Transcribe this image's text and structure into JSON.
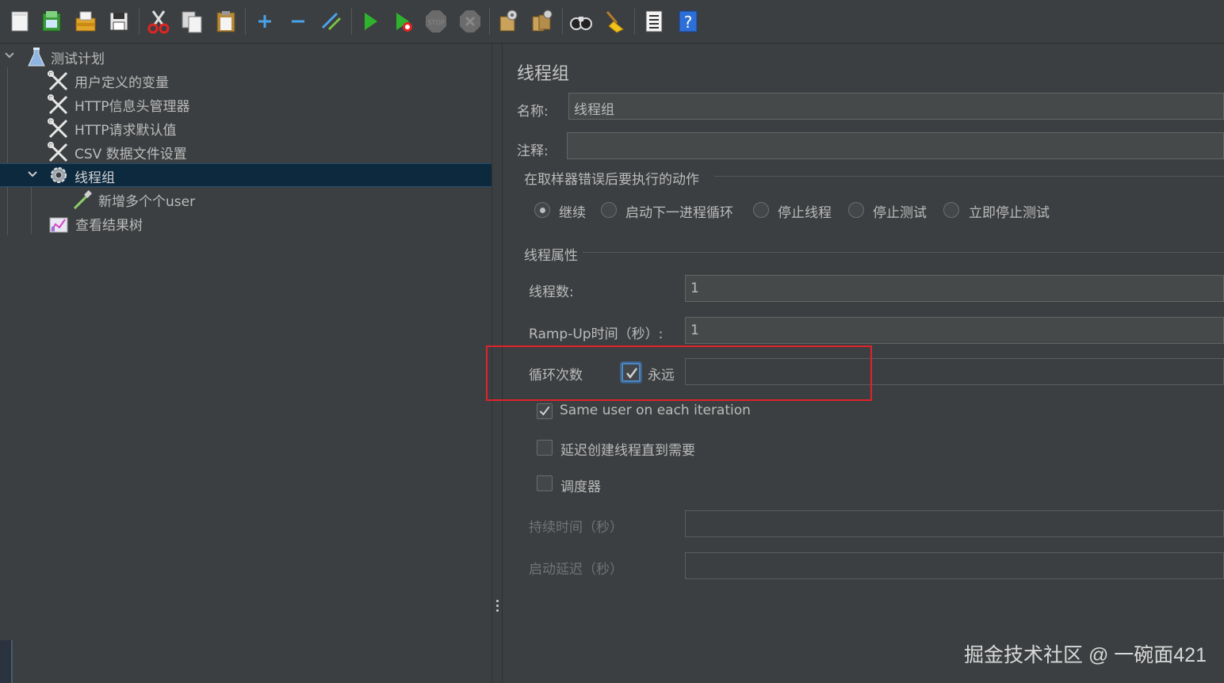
{
  "toolbar": {
    "buttons": [
      {
        "icon": "new-icon"
      },
      {
        "icon": "templates-icon"
      },
      {
        "icon": "open-icon"
      },
      {
        "icon": "save-icon"
      },
      {
        "icon": "cut-icon"
      },
      {
        "icon": "copy-icon"
      },
      {
        "icon": "paste-icon"
      },
      {
        "icon": "expand-icon"
      },
      {
        "icon": "collapse-icon"
      },
      {
        "icon": "toggle-icon"
      },
      {
        "icon": "start-icon"
      },
      {
        "icon": "start-no-pauses-icon"
      },
      {
        "icon": "stop-icon",
        "label": "STOP"
      },
      {
        "icon": "shutdown-icon"
      },
      {
        "icon": "clear-icon"
      },
      {
        "icon": "clear-all-icon"
      },
      {
        "icon": "search-icon"
      },
      {
        "icon": "reset-search-icon"
      },
      {
        "icon": "function-helper-icon"
      },
      {
        "icon": "help-icon",
        "label": "?"
      }
    ]
  },
  "tree": {
    "items": [
      {
        "label": "测试计划",
        "icon": "test-plan-icon",
        "expanded": true
      },
      {
        "label": "用户定义的变量",
        "icon": "config-element-icon"
      },
      {
        "label": "HTTP信息头管理器",
        "icon": "config-element-icon"
      },
      {
        "label": "HTTP请求默认值",
        "icon": "config-element-icon"
      },
      {
        "label": "CSV 数据文件设置",
        "icon": "config-element-icon"
      },
      {
        "label": "线程组",
        "icon": "thread-group-gear-icon",
        "expanded": true,
        "selected": true
      },
      {
        "label": "新增多个个user",
        "icon": "sampler-pipette-icon"
      },
      {
        "label": "查看结果树",
        "icon": "listener-chart-icon"
      }
    ]
  },
  "panel": {
    "title": "线程组",
    "name_label": "名称:",
    "name_value": "线程组",
    "comment_label": "注释:",
    "comment_value": "",
    "error_action": {
      "legend": "在取样器错误后要执行的动作",
      "options": [
        "继续",
        "启动下一进程循环",
        "停止线程",
        "停止测试",
        "立即停止测试"
      ],
      "selected": "继续"
    },
    "thread_props": {
      "legend": "线程属性",
      "threads_label": "线程数:",
      "threads_value": "1",
      "rampup_label": "Ramp-Up时间（秒）:",
      "rampup_value": "1",
      "loop_label": "循环次数",
      "forever_label": "永远",
      "forever_checked": true,
      "loop_value": "",
      "same_user_label": "Same user on each iteration",
      "same_user_checked": true,
      "delay_label": "延迟创建线程直到需要",
      "delay_checked": false,
      "scheduler_label": "调度器",
      "scheduler_checked": false,
      "duration_label": "持续时间（秒）",
      "duration_value": "",
      "startup_delay_label": "启动延迟（秒）",
      "startup_delay_value": ""
    }
  },
  "watermark": "掘金技术社区 @ 一碗面421",
  "colors": {
    "background": "#3c3f41",
    "selection": "#0d293e",
    "text": "#bbbbbb",
    "highlight_box": "#e0222a",
    "checkbox_focus": "#4a88c7"
  }
}
